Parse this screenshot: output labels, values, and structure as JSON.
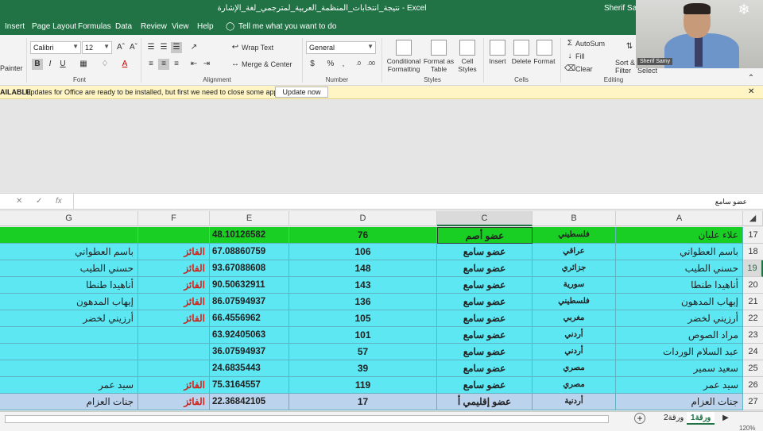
{
  "window": {
    "title": "نتيجة_انتخابات_المنظمة_العربية_لمترجمي_لغة_الإشارة  -  Excel",
    "user": "Sherif Samy"
  },
  "tabs": [
    "Insert",
    "Page Layout",
    "Formulas",
    "Data",
    "Review",
    "View",
    "Help"
  ],
  "tell_me": "Tell me what you want to do",
  "ribbon": {
    "paste_partial": "Painter",
    "font_name": "Calibri",
    "font_size": "12",
    "font_group": "Font",
    "alignment_group": "Alignment",
    "number_group": "Number",
    "styles_group": "Styles",
    "cells_group": "Cells",
    "editing_group": "Editing",
    "wrap_text": "Wrap Text",
    "merge_center": "Merge & Center",
    "number_format": "General",
    "conditional_formatting": "Conditional Formatting",
    "format_as_table": "Format as Table",
    "cell_styles": "Cell Styles",
    "insert": "Insert",
    "delete": "Delete",
    "format": "Format",
    "autosum": "AutoSum",
    "fill": "Fill",
    "clear": "Clear",
    "sort_filter": "Sort & Filter",
    "find_select": "Select"
  },
  "notice": {
    "label": "AILABLE",
    "message": "Updates for Office are ready to be installed, but first we need to close some apps.",
    "button": "Update now"
  },
  "formula_bar": {
    "content": "عضو سامع"
  },
  "columns": [
    "G",
    "F",
    "E",
    "D",
    "C",
    "B",
    "A"
  ],
  "rows": [
    {
      "n": "17",
      "A": "علاء عليان",
      "B": "فلسطيني",
      "C": "عضو أصم",
      "D": "76",
      "E": "48.10126582",
      "F": "",
      "G": "",
      "bg": "#19cf23"
    },
    {
      "n": "18",
      "A": "باسم العطواني",
      "B": "عراقي",
      "C": "عضو سامع",
      "D": "106",
      "E": "67.08860759",
      "F": "الفائز",
      "G": "باسم العطواني",
      "bg": "#5ce7f3"
    },
    {
      "n": "19",
      "A": "حسني الطيب",
      "B": "جزائري",
      "C": "عضو سامع",
      "D": "148",
      "E": "93.67088608",
      "F": "الفائز",
      "G": "حسني الطيب",
      "bg": "#5ce7f3"
    },
    {
      "n": "20",
      "A": "أناهيدا طنطا",
      "B": "سورية",
      "C": "عضو سامع",
      "D": "143",
      "E": "90.50632911",
      "F": "الفائز",
      "G": "أناهيدا طنطا",
      "bg": "#5ce7f3"
    },
    {
      "n": "21",
      "A": "إيهاب المدهون",
      "B": "فلسطيني",
      "C": "عضو سامع",
      "D": "136",
      "E": "86.07594937",
      "F": "الفائز",
      "G": "إيهاب المدهون",
      "bg": "#5ce7f3"
    },
    {
      "n": "22",
      "A": "أرزيني لخضر",
      "B": "مغربي",
      "C": "عضو سامع",
      "D": "105",
      "E": "66.4556962",
      "F": "الفائز",
      "G": "أرزيني لخضر",
      "bg": "#5ce7f3"
    },
    {
      "n": "23",
      "A": "مراد الصوص",
      "B": "أردني",
      "C": "عضو سامع",
      "D": "101",
      "E": "63.92405063",
      "F": "",
      "G": "",
      "bg": "#5ce7f3"
    },
    {
      "n": "24",
      "A": "عبد السلام الوردات",
      "B": "أردني",
      "C": "عضو سامع",
      "D": "57",
      "E": "36.07594937",
      "F": "",
      "G": "",
      "bg": "#5ce7f3"
    },
    {
      "n": "25",
      "A": "سعيد سمير",
      "B": "مصري",
      "C": "عضو سامع",
      "D": "39",
      "E": "24.6835443",
      "F": "",
      "G": "",
      "bg": "#5ce7f3"
    },
    {
      "n": "26",
      "A": "سيد عمر",
      "B": "مصري",
      "C": "عضو سامع",
      "D": "119",
      "E": "75.3164557",
      "F": "الفائز",
      "G": "سيد عمر",
      "bg": "#5ce7f3"
    },
    {
      "n": "27",
      "A": "جنات العزام",
      "B": "أردنية",
      "C": "عضو إقليمي أ",
      "D": "17",
      "E": "22.36842105",
      "F": "الفائز",
      "G": "جنات العزام",
      "bg": "#bcd3ee"
    }
  ],
  "sheets": [
    "ورقة2",
    "ورقة1"
  ],
  "zoom": "120%",
  "video": {
    "name": "Sherif Samy"
  },
  "colors": {
    "green_header": "#217346",
    "winner_red": "#d0231a",
    "cyan_rows": "#5ce7f3",
    "green_row": "#19cf23",
    "blue_row": "#bcd3ee"
  }
}
